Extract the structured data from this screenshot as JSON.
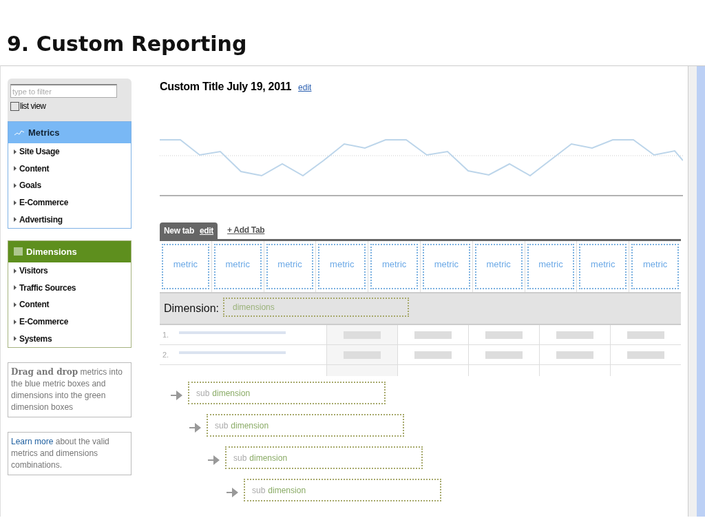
{
  "slide_title": "9. Custom Reporting",
  "sidebar": {
    "filter": {
      "placeholder": "type to filter"
    },
    "list_view": {
      "label": "list view",
      "checked": false
    },
    "metrics": {
      "title": "Metrics",
      "items": [
        "Site Usage",
        "Content",
        "Goals",
        "E-Commerce",
        "Advertising"
      ]
    },
    "dimensions": {
      "title": "Dimensions",
      "items": [
        "Visitors",
        "Traffic Sources",
        "Content",
        "E-Commerce",
        "Systems"
      ]
    },
    "help": "**Drag and drop** metrics into the blue metric boxes and dimensions into the green dimension boxes",
    "learn": {
      "link": "Learn more",
      "text": "about the valid metrics and dimensions combinations."
    }
  },
  "report": {
    "title": "Custom Title July 19, 2011",
    "edit": "edit",
    "tabs": [
      {
        "label": "New tab",
        "edit": "edit",
        "selected": true
      }
    ],
    "add_tab": "+ Add Tab",
    "metric_boxes": [
      "metric",
      "metric",
      "metric",
      "metric",
      "metric",
      "metric",
      "metric",
      "metric",
      "metric",
      "metric"
    ],
    "dimension_label": "Dimension:",
    "dimension_box": "dimensions",
    "rows": [
      "1.",
      "2.",
      ""
    ],
    "sub_dimensions": [
      {
        "prefix": "sub",
        "word": "dimension"
      },
      {
        "prefix": "sub",
        "word": "dimension"
      },
      {
        "prefix": "sub",
        "word": "dimension"
      },
      {
        "prefix": "sub",
        "word": "dimension"
      }
    ]
  }
}
